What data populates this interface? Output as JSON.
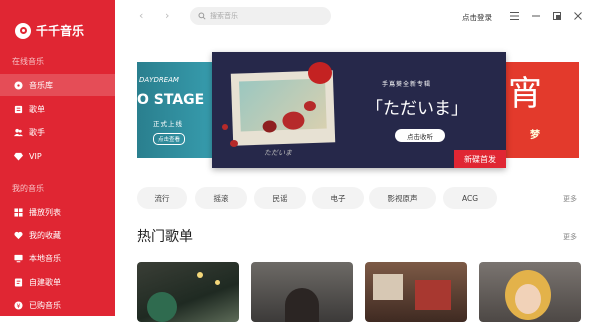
{
  "app": {
    "title": "千千音乐"
  },
  "sidebar": {
    "online_title": "在线音乐",
    "online_items": [
      {
        "label": "音乐库",
        "icon": "disc-icon"
      },
      {
        "label": "歌单",
        "icon": "playlist-icon"
      },
      {
        "label": "歌手",
        "icon": "singer-icon"
      },
      {
        "label": "VIP",
        "icon": "diamond-icon"
      }
    ],
    "my_title": "我的音乐",
    "my_items": [
      {
        "label": "播放列表",
        "icon": "list-icon"
      },
      {
        "label": "我的收藏",
        "icon": "heart-icon"
      },
      {
        "label": "本地音乐",
        "icon": "computer-icon"
      },
      {
        "label": "自建歌单",
        "icon": "edit-icon"
      },
      {
        "label": "已购音乐",
        "icon": "purchase-icon"
      }
    ]
  },
  "topbar": {
    "search_placeholder": "搜索音乐",
    "login": "点击登录"
  },
  "banner": {
    "left_line1": "DAYDREAM",
    "left_line2": "O STAGE",
    "left_line3": "正式上线",
    "left_line4": "点击查看",
    "center_subtitle": "手嶌葵全新专辑",
    "center_title": "「ただいま」",
    "center_button": "点击收听",
    "center_signature": "ただいま",
    "center_tag": "新碟首发",
    "right_big": "宵",
    "right_small": "梦"
  },
  "categories": [
    "流行",
    "摇滚",
    "民谣",
    "电子",
    "影视原声",
    "ACG"
  ],
  "more_label": "更多",
  "section": {
    "title": "热门歌单",
    "more": "更多"
  },
  "colors": {
    "brand": "#e02633",
    "banner_dark": "#26284a"
  }
}
